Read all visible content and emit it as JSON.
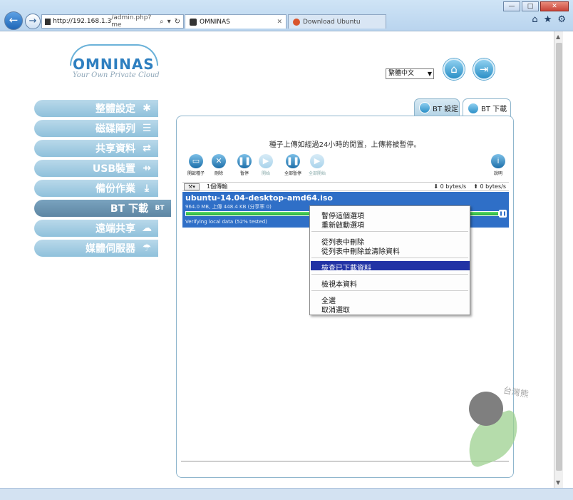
{
  "browser": {
    "url_host": "http://192.168.1.3",
    "url_path": "/admin.php?me",
    "tabs": [
      {
        "label": "OMNINAS"
      },
      {
        "label": "Download Ubuntu"
      }
    ],
    "window_buttons": [
      "—",
      "□",
      "✕"
    ]
  },
  "header": {
    "logo_name": "OMNINAS",
    "logo_tagline": "Your Own Private Cloud",
    "language": "繁體中文"
  },
  "sidebar": {
    "items": [
      {
        "label": "整體設定"
      },
      {
        "label": "磁碟陣列"
      },
      {
        "label": "共享資料"
      },
      {
        "label": "USB裝置"
      },
      {
        "label": "備份作業"
      },
      {
        "label": "BT 下載"
      },
      {
        "label": "遠端共享"
      },
      {
        "label": "媒體伺服器"
      }
    ]
  },
  "panel_tabs": [
    {
      "label": "BT 設定"
    },
    {
      "label": "BT 下載"
    }
  ],
  "notice": "種子上傳如經過24小時的閒置，上傳將被暫停。",
  "toolbar": {
    "buttons": [
      {
        "label": "開啟種子"
      },
      {
        "label": "刪除"
      },
      {
        "label": "暫停"
      },
      {
        "label": "開始"
      },
      {
        "label": "全部暫停"
      },
      {
        "label": "全部開始"
      },
      {
        "label": "說明"
      }
    ]
  },
  "list_header": {
    "count": "1個傳輸",
    "down_speed": "0 bytes/s",
    "up_speed": "0 bytes/s"
  },
  "torrent": {
    "name": "ubuntu-14.04-desktop-amd64.iso",
    "sub": "964.0 MB, 上傳 448.4 KB (分享率 0)",
    "status": "Verifying local data (52% tested)",
    "progress": 1.0
  },
  "context_menu": {
    "items": [
      {
        "label": "暫停這個選項"
      },
      {
        "label": "重新啟動選項"
      },
      {
        "label": "從列表中刪除"
      },
      {
        "label": "從列表中刪除並清除資料"
      },
      {
        "label": "檢查已下載資料"
      },
      {
        "label": "檢視本資料"
      },
      {
        "label": "全選"
      },
      {
        "label": "取消選取"
      }
    ]
  },
  "watermark": {
    "text": "台灣熊"
  }
}
